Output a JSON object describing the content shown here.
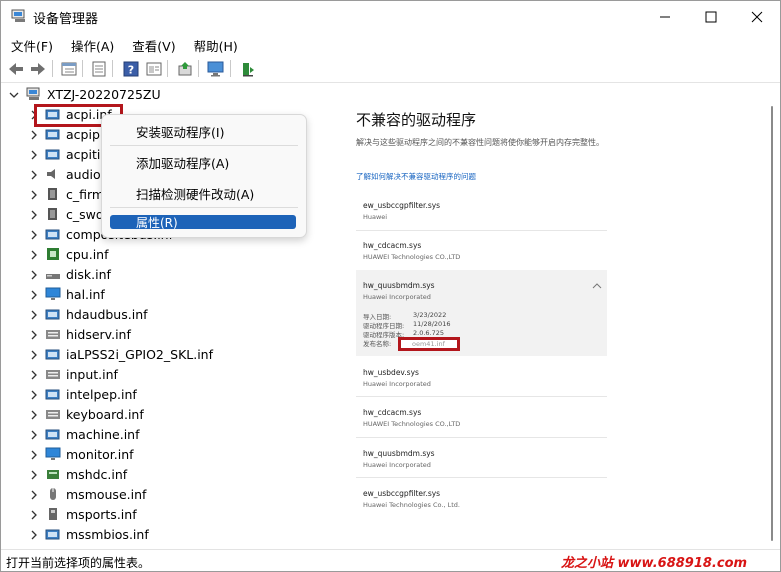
{
  "window": {
    "title": "设备管理器"
  },
  "window_controls": {
    "minimize": "minimize-icon",
    "maximize": "maximize-icon",
    "close": "close-icon"
  },
  "menu": [
    "文件(F)",
    "操作(A)",
    "查看(V)",
    "帮助(H)"
  ],
  "toolbar": [
    "back-arrow-icon",
    "forward-arrow-icon",
    "properties-grid-icon",
    "document-icon",
    "help-icon",
    "sheet-icon",
    "update-driver-icon",
    "monitor-scan-icon",
    "add-hardware-icon"
  ],
  "tree": {
    "root": "XTZJ-20220725ZU",
    "items": [
      {
        "label": "acpi.inf",
        "icon": "adapter-icon"
      },
      {
        "label": "acpip",
        "icon": "adapter-icon"
      },
      {
        "label": "acpiti",
        "icon": "adapter-icon"
      },
      {
        "label": "audio",
        "icon": "speaker-icon"
      },
      {
        "label": "c_firm",
        "icon": "chip-icon"
      },
      {
        "label": "c_swd",
        "icon": "chip-icon"
      },
      {
        "label": "compositebus.inf",
        "icon": "adapter-icon"
      },
      {
        "label": "cpu.inf",
        "icon": "cpu-icon"
      },
      {
        "label": "disk.inf",
        "icon": "disk-icon"
      },
      {
        "label": "hal.inf",
        "icon": "monitor-icon"
      },
      {
        "label": "hdaudbus.inf",
        "icon": "adapter-icon"
      },
      {
        "label": "hidserv.inf",
        "icon": "keyboard-icon"
      },
      {
        "label": "iaLPSS2i_GPIO2_SKL.inf",
        "icon": "adapter-icon"
      },
      {
        "label": "input.inf",
        "icon": "keyboard-icon"
      },
      {
        "label": "intelpep.inf",
        "icon": "adapter-icon"
      },
      {
        "label": "keyboard.inf",
        "icon": "keyboard-icon"
      },
      {
        "label": "machine.inf",
        "icon": "adapter-icon"
      },
      {
        "label": "monitor.inf",
        "icon": "monitor-icon"
      },
      {
        "label": "mshdc.inf",
        "icon": "drive-icon"
      },
      {
        "label": "msmouse.inf",
        "icon": "mouse-icon"
      },
      {
        "label": "msports.inf",
        "icon": "port-icon"
      },
      {
        "label": "mssmbios.inf",
        "icon": "adapter-icon"
      }
    ]
  },
  "context_menu": {
    "items": [
      "安装驱动程序(I)",
      "添加驱动程序(A)",
      "扫描检测硬件改动(A)",
      "属性(R)"
    ],
    "selected": "属性(R)"
  },
  "panel": {
    "title": "不兼容的驱动程序",
    "description": "解决与这些驱动程序之间的不兼容性问题将使你能够开启内存完整性。",
    "link": "了解如何解决不兼容驱动程序的问题",
    "drivers": [
      {
        "name": "ew_usbccgpfilter.sys",
        "vendor": "Huawei"
      },
      {
        "name": "hw_cdcacm.sys",
        "vendor": "HUAWEI Technologies CO.,LTD"
      },
      {
        "name": "hw_quusbmdm.sys",
        "vendor": "Huawei Incorporated",
        "expanded": true
      },
      {
        "name": "hw_usbdev.sys",
        "vendor": "Huawei Incorporated"
      },
      {
        "name": "hw_cdcacm.sys",
        "vendor": "HUAWEI Technologies CO.,LTD"
      },
      {
        "name": "hw_quusbmdm.sys",
        "vendor": "Huawei Incorporated"
      },
      {
        "name": "ew_usbccgpfilter.sys",
        "vendor": "Huawei Technologies Co., Ltd."
      }
    ],
    "details": [
      {
        "key": "导入日期:",
        "value": "3/23/2022"
      },
      {
        "key": "驱动程序日期:",
        "value": "11/28/2016"
      },
      {
        "key": "驱动程序版本:",
        "value": "2.0.6.725"
      },
      {
        "key": "发布名称:",
        "value": "oem41.inf"
      }
    ]
  },
  "status": {
    "text": "打开当前选择项的属性表。"
  },
  "watermark": "龙之小站 www.688918.com"
}
